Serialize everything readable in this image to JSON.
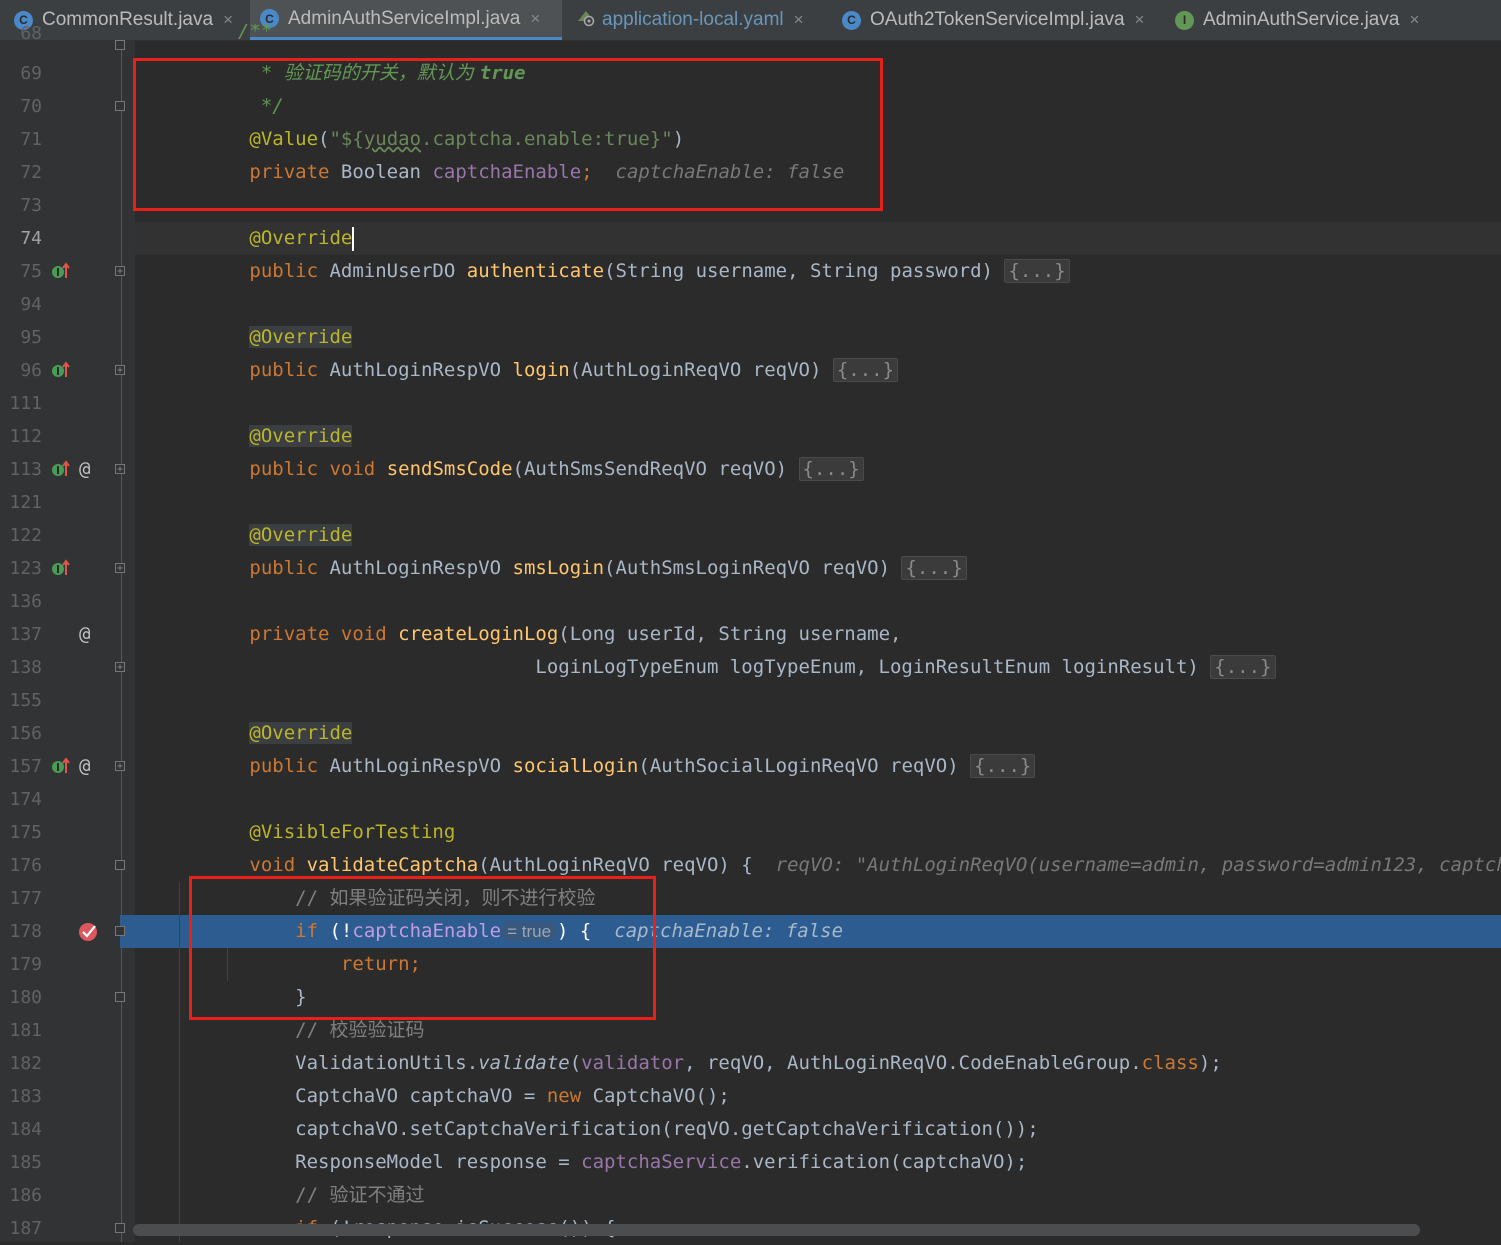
{
  "tabs": [
    {
      "label": "CommonResult.java",
      "icon": "class-icon",
      "color": "#4a88c7"
    },
    {
      "label": "AdminAuthServiceImpl.java",
      "icon": "class-icon",
      "color": "#4a88c7",
      "active": true
    },
    {
      "label": "application-local.yaml",
      "icon": "yaml-icon",
      "color": "#6a8759"
    },
    {
      "label": "OAuth2TokenServiceImpl.java",
      "icon": "class-icon",
      "color": "#4a88c7"
    },
    {
      "label": "AdminAuthService.java",
      "icon": "interface-icon",
      "color": "#629755"
    }
  ],
  "tab_icon_letters": {
    "class": "C",
    "interface": "I"
  },
  "close_glyph": "×",
  "lines": [
    "68",
    "69",
    "70",
    "71",
    "72",
    "73",
    "74",
    "75",
    "94",
    "95",
    "96",
    "111",
    "112",
    "113",
    "121",
    "122",
    "123",
    "136",
    "137",
    "138",
    "155",
    "156",
    "157",
    "174",
    "175",
    "176",
    "177",
    "178",
    "179",
    "180",
    "181",
    "182",
    "183",
    "184",
    "185",
    "186",
    "187"
  ],
  "code": {
    "l69": {
      "star": "* ",
      "text": "验证码的开关，默认为 ",
      "val": "true"
    },
    "l70": "*/",
    "l71": {
      "ann": "@Value",
      "p1": "(",
      "str1": "\"${",
      "key": "yudao",
      "str2": ".captcha.enable:true}\"",
      "p2": ")"
    },
    "l72": {
      "kw": "private",
      "type": "Boolean",
      "field": "captchaEnable",
      "semi": ";",
      "hint": "captchaEnable: false"
    },
    "l74": "@Override",
    "l75": {
      "kw": "public",
      "type": "AdminUserDO",
      "fn": "authenticate",
      "params": "(String username, String password)",
      "fold": "{...}"
    },
    "l95": "@Override",
    "l96": {
      "kw": "public",
      "type": "AuthLoginRespVO",
      "fn": "login",
      "params": "(AuthLoginReqVO reqVO)",
      "fold": "{...}"
    },
    "l112": "@Override",
    "l113": {
      "kw": "public void",
      "fn": "sendSmsCode",
      "params": "(AuthSmsSendReqVO reqVO)",
      "fold": "{...}"
    },
    "l122": "@Override",
    "l123": {
      "kw": "public",
      "type": "AuthLoginRespVO",
      "fn": "smsLogin",
      "params": "(AuthSmsLoginReqVO reqVO)",
      "fold": "{...}"
    },
    "l137": {
      "kw": "private void",
      "fn": "createLoginLog",
      "params": "(Long userId, String username,"
    },
    "l138": {
      "params": "LoginLogTypeEnum logTypeEnum, LoginResultEnum loginResult)",
      "fold": "{...}"
    },
    "l156": "@Override",
    "l157": {
      "kw": "public",
      "type": "AuthLoginRespVO",
      "fn": "socialLogin",
      "params": "(AuthSocialLoginReqVO reqVO)",
      "fold": "{...}"
    },
    "l175": "@VisibleForTesting",
    "l176": {
      "kw": "void",
      "fn": "validateCaptcha",
      "params": "(AuthLoginReqVO reqVO) {",
      "hint": "reqVO: \"AuthLoginReqVO(username=admin, password=admin123, captch"
    },
    "l177": "// 如果验证码关闭，则不进行校验",
    "l178": {
      "kw": "if",
      "p1": " (!",
      "field": "captchaEnable",
      "inlay": "= true",
      "p2": ") {",
      "hint": "captchaEnable: false"
    },
    "l179": "return;",
    "l180": "}",
    "l181": "// 校验验证码",
    "l182": {
      "cls": "ValidationUtils.",
      "method": "validate",
      "p1": "(",
      "field": "validator",
      "p2": ", reqVO, AuthLoginReqVO.CodeEnableGroup.",
      "kw": "class",
      "p3": ");"
    },
    "l183": {
      "a": "CaptchaVO captchaVO = ",
      "kw": "new",
      "b": " CaptchaVO();"
    },
    "l184": "captchaVO.setCaptchaVerification(reqVO.getCaptchaVerification());",
    "l185": {
      "a": "ResponseModel response = ",
      "field": "captchaService",
      "b": ".verification(captchaVO);"
    },
    "l186": "// 验证不通过",
    "l187": {
      "kw": "if",
      "b": " (!response.isSuccess()) {"
    }
  },
  "colors": {
    "highlight_box": "#e8201a",
    "breakpoint_line": "#2d5c91",
    "editor_bg": "#2b2b2b"
  }
}
